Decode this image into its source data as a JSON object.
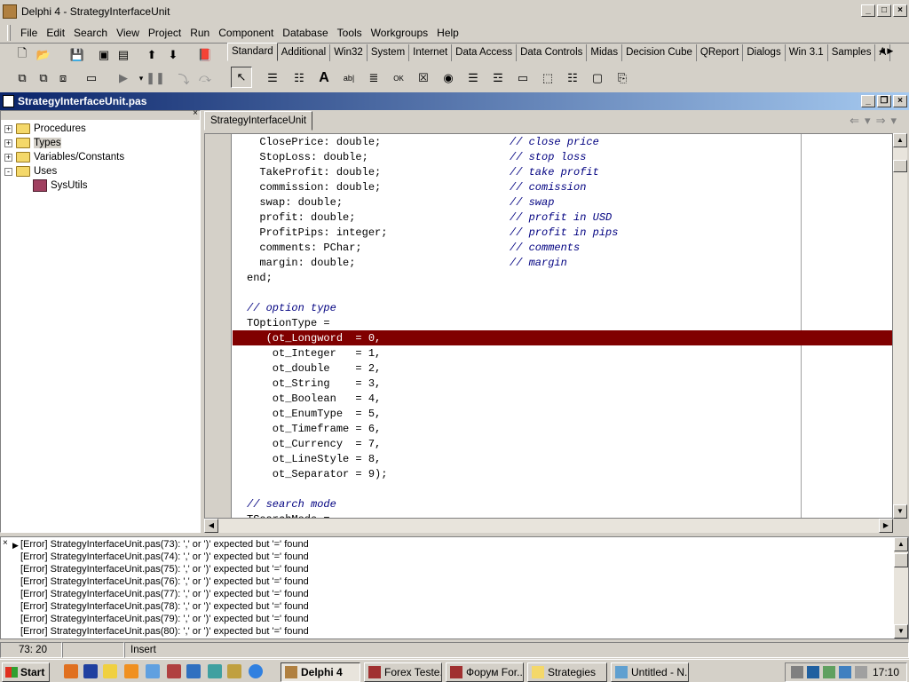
{
  "window": {
    "title": "Delphi 4 - StrategyInterfaceUnit"
  },
  "menu": [
    "File",
    "Edit",
    "Search",
    "View",
    "Project",
    "Run",
    "Component",
    "Database",
    "Tools",
    "Workgroups",
    "Help"
  ],
  "palette_tabs": [
    "Standard",
    "Additional",
    "Win32",
    "System",
    "Internet",
    "Data Access",
    "Data Controls",
    "Midas",
    "Decision Cube",
    "QReport",
    "Dialogs",
    "Win 3.1",
    "Samples",
    "A"
  ],
  "editor": {
    "title": "StrategyInterfaceUnit.pas",
    "tab": "StrategyInterfaceUnit"
  },
  "tree": [
    {
      "label": "Procedures",
      "expander": "+"
    },
    {
      "label": "Types",
      "expander": "+"
    },
    {
      "label": "Variables/Constants",
      "expander": "+"
    },
    {
      "label": "Uses",
      "expander": "-"
    },
    {
      "label": "SysUtils",
      "expander": ""
    }
  ],
  "code": [
    {
      "code": "  ClosePrice: double;",
      "comment": "// close price"
    },
    {
      "code": "  StopLoss: double;",
      "comment": "// stop loss"
    },
    {
      "code": "  TakeProfit: double;",
      "comment": "// take profit"
    },
    {
      "code": "  commission: double;",
      "comment": "// comission"
    },
    {
      "code": "  swap: double;",
      "comment": "// swap"
    },
    {
      "code": "  profit: double;",
      "comment": "// profit in USD"
    },
    {
      "code": "  ProfitPips: integer;",
      "comment": "// profit in pips"
    },
    {
      "code": "  comments: PChar;",
      "comment": "// comments"
    },
    {
      "code": "  margin: double;",
      "comment": "// margin"
    },
    {
      "code": "end;",
      "comment": ""
    },
    {
      "code": "",
      "comment": ""
    },
    {
      "code": "",
      "comment": "// option type"
    },
    {
      "code": "TOptionType =",
      "comment": ""
    },
    {
      "code": "   (ot_Longword  = 0,",
      "comment": ""
    },
    {
      "code": "    ot_Integer   = 1,",
      "comment": ""
    },
    {
      "code": "    ot_double    = 2,",
      "comment": ""
    },
    {
      "code": "    ot_String    = 3,",
      "comment": ""
    },
    {
      "code": "    ot_Boolean   = 4,",
      "comment": ""
    },
    {
      "code": "    ot_EnumType  = 5,",
      "comment": ""
    },
    {
      "code": "    ot_Timeframe = 6,",
      "comment": ""
    },
    {
      "code": "    ot_Currency  = 7,",
      "comment": ""
    },
    {
      "code": "    ot_LineStyle = 8,",
      "comment": ""
    },
    {
      "code": "    ot_Separator = 9);",
      "comment": ""
    },
    {
      "code": "",
      "comment": ""
    },
    {
      "code": "",
      "comment": "// search mode"
    },
    {
      "code": "TSearchMode =",
      "comment": ""
    }
  ],
  "messages": [
    "[Error] StrategyInterfaceUnit.pas(73): ',' or ')' expected but '=' found",
    "[Error] StrategyInterfaceUnit.pas(74): ',' or ')' expected but '=' found",
    "[Error] StrategyInterfaceUnit.pas(75): ',' or ')' expected but '=' found",
    "[Error] StrategyInterfaceUnit.pas(76): ',' or ')' expected but '=' found",
    "[Error] StrategyInterfaceUnit.pas(77): ',' or ')' expected but '=' found",
    "[Error] StrategyInterfaceUnit.pas(78): ',' or ')' expected but '=' found",
    "[Error] StrategyInterfaceUnit.pas(79): ',' or ')' expected but '=' found",
    "[Error] StrategyInterfaceUnit.pas(80): ',' or ')' expected but '=' found"
  ],
  "status": {
    "position": "73: 20",
    "mode": "Insert"
  },
  "taskbar": {
    "start": "Start",
    "tasks": [
      "Delphi 4",
      "Forex Teste...",
      "Форум For...",
      "Strategies",
      "Untitled - N..."
    ],
    "clock": "17:10"
  },
  "colors": {
    "highlight": "#800000",
    "title_gradient_start": "#0a246a",
    "title_gradient_end": "#a6caf0"
  }
}
